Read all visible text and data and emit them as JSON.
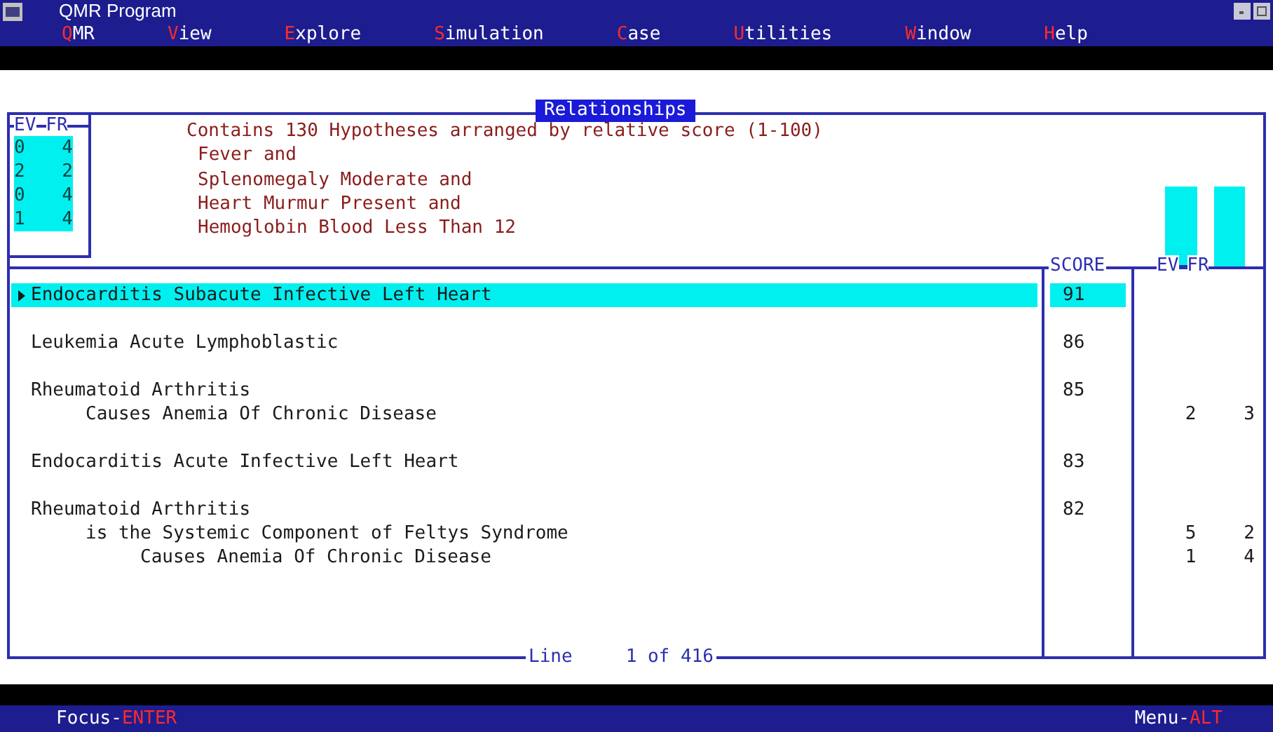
{
  "window": {
    "title": "QMR Program"
  },
  "menu": [
    {
      "hotkey": "Q",
      "rest": "MR"
    },
    {
      "hotkey": "V",
      "rest": "iew"
    },
    {
      "hotkey": "E",
      "rest": "xplore"
    },
    {
      "hotkey": "S",
      "rest": "imulation"
    },
    {
      "hotkey": "C",
      "rest": "ase"
    },
    {
      "hotkey": "U",
      "rest": "tilities"
    },
    {
      "hotkey": "W",
      "rest": "indow"
    },
    {
      "hotkey": "H",
      "rest": "elp"
    }
  ],
  "panel": {
    "title": "Relationships",
    "findings_box": {
      "header": [
        "EV",
        "FR"
      ],
      "rows": [
        {
          "ev": "0",
          "fr": "4"
        },
        {
          "ev": "2",
          "fr": "2"
        },
        {
          "ev": "0",
          "fr": "4"
        },
        {
          "ev": "1",
          "fr": "4"
        }
      ]
    },
    "summary": "Contains 130 Hypotheses arranged by relative score (1-100)",
    "findings": [
      "Fever and",
      "Splenomegaly Moderate and",
      "Heart Murmur Present and",
      "Hemoglobin Blood Less Than 12"
    ],
    "columns": {
      "score": "SCORE",
      "ev": "EV",
      "fr": "FR"
    },
    "hypotheses": [
      {
        "name": "Endocarditis Subacute Infective Left Heart",
        "score": "91",
        "selected": true
      },
      {
        "name": "Leukemia Acute Lymphoblastic",
        "score": "86",
        "selected": false
      },
      {
        "name": "Rheumatoid Arthritis",
        "score": "85",
        "selected": false,
        "children": [
          {
            "name": "Causes Anemia Of Chronic Disease",
            "ev": "2",
            "fr": "3"
          }
        ]
      },
      {
        "name": "Endocarditis Acute Infective Left Heart",
        "score": "83",
        "selected": false
      },
      {
        "name": "Rheumatoid Arthritis",
        "score": "82",
        "selected": false,
        "children": [
          {
            "name": "is the Systemic Component of Feltys Syndrome",
            "ev": "5",
            "fr": "2",
            "children": [
              {
                "name": "Causes Anemia Of Chronic Disease",
                "ev": "1",
                "fr": "4"
              }
            ]
          }
        ]
      }
    ],
    "footer": {
      "label": "Line",
      "position": "1 of 416"
    }
  },
  "status_bar": [
    {
      "label": "Focus-",
      "key": "ENTER"
    },
    {
      "label": "Menu-",
      "key": "ALT"
    }
  ]
}
